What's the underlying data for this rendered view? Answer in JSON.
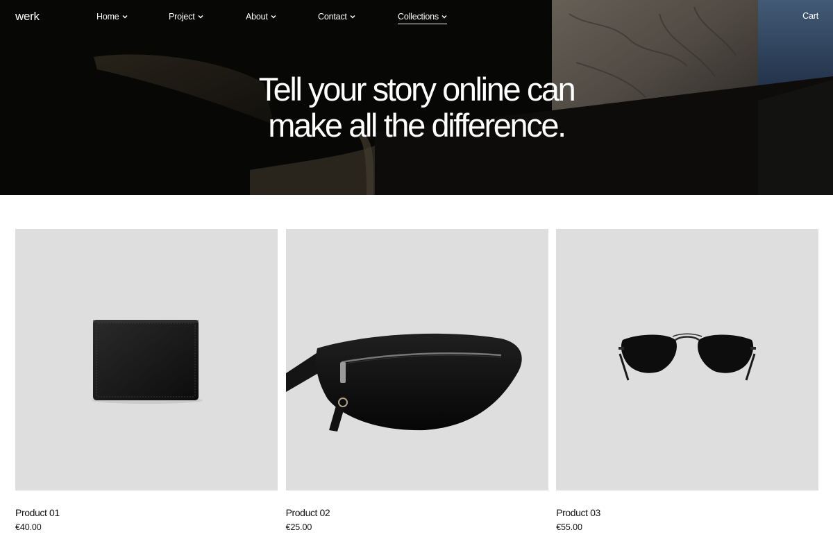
{
  "brand": "werk",
  "nav": [
    {
      "label": "Home",
      "name": "nav-home",
      "active": false
    },
    {
      "label": "Project",
      "name": "nav-project",
      "active": false
    },
    {
      "label": "About",
      "name": "nav-about",
      "active": false
    },
    {
      "label": "Contact",
      "name": "nav-contact",
      "active": false
    },
    {
      "label": "Collections",
      "name": "nav-collections",
      "active": true
    }
  ],
  "cart_label": "Cart",
  "hero": {
    "line1": "Tell your story online can",
    "line2": "make all the difference."
  },
  "products": [
    {
      "title": "Product 01",
      "price": "€40.00",
      "image": "wallet"
    },
    {
      "title": "Product 02",
      "price": "€25.00",
      "image": "belt-bag"
    },
    {
      "title": "Product 03",
      "price": "€55.00",
      "image": "aviator-sunglasses"
    }
  ],
  "colors": {
    "hero_bg": "#0b0a09",
    "card_bg": "#dedede",
    "text": "#111111",
    "hero_text": "#ffffff"
  }
}
